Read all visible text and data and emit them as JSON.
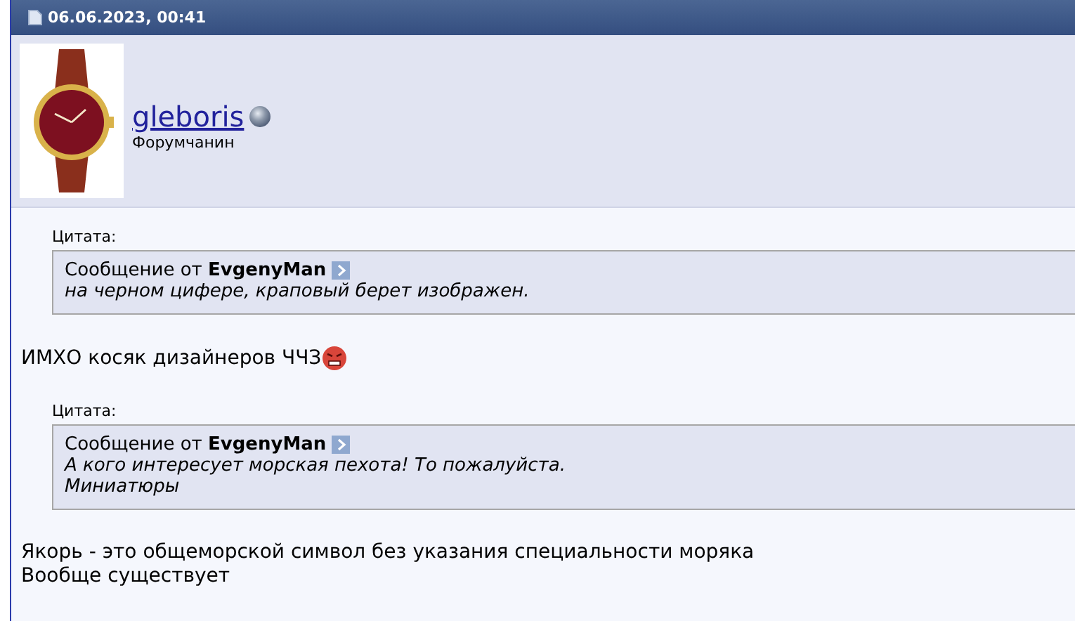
{
  "post": {
    "date": "06.06.2023, 00:41",
    "user": {
      "name": "gleboris",
      "title": "Форумчанин"
    },
    "blocks": [
      {
        "kind": "quote",
        "label": "Цитата:",
        "author_prefix": "Сообщение от",
        "author": "EvgenyMan",
        "lines": [
          "на черном цифере, краповый берет изображен."
        ]
      },
      {
        "kind": "text",
        "lines": [
          "ИМХО косяк дизайнеров ЧЧЗ"
        ],
        "emoticon": true
      },
      {
        "kind": "quote",
        "label": "Цитата:",
        "author_prefix": "Сообщение от",
        "author": "EvgenyMan",
        "lines": [
          "А кого интересует морская пехота! То пожалуйста.",
          "Миниатюры"
        ]
      },
      {
        "kind": "text",
        "lines": [
          "Якорь - это общеморской символ без указания специальности моряка",
          "Вообще существует"
        ],
        "emoticon": false
      }
    ]
  }
}
